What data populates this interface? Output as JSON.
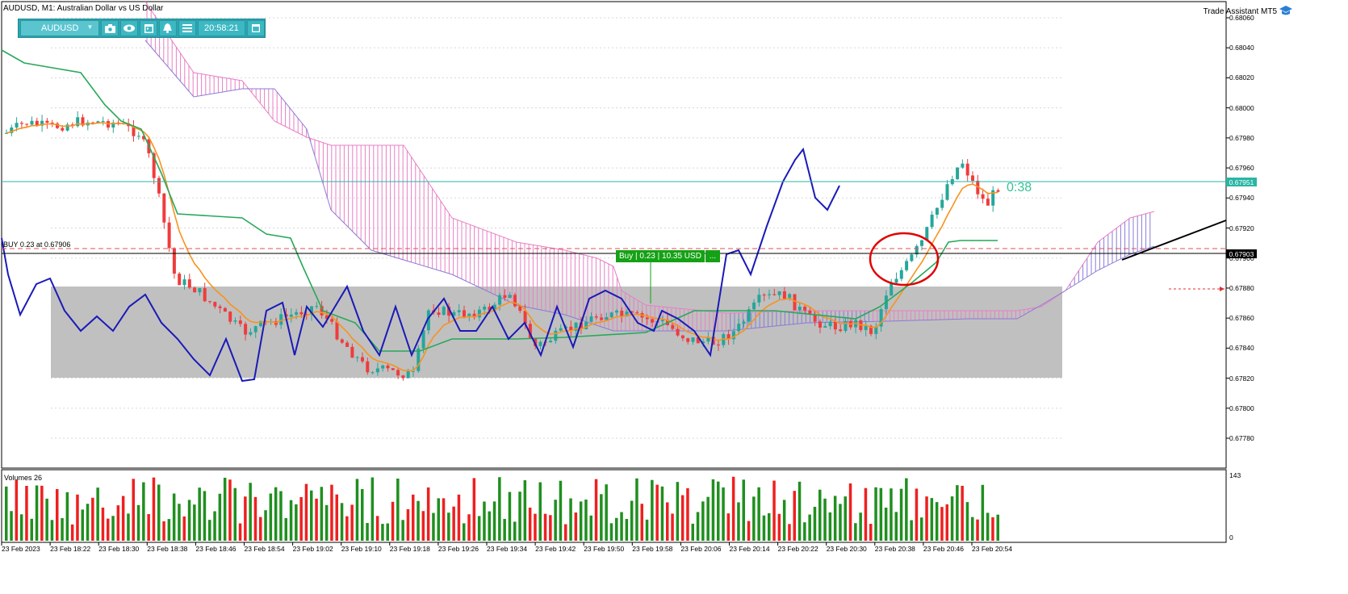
{
  "window": {
    "title": "AUDUSD, M1:  Australian Dollar vs US Dollar",
    "brand": "Trade Assistant MT5"
  },
  "toolbar": {
    "symbol": "AUDUSD",
    "time": "20:58:21",
    "icons": [
      "camera-icon",
      "eye-icon",
      "calendar-icon",
      "alarm-icon",
      "menu-icon",
      "window-icon"
    ]
  },
  "price_axis": {
    "labels": [
      "0.68060",
      "0.68040",
      "0.68020",
      "0.68000",
      "0.67980",
      "0.67960",
      "0.67940",
      "0.67920",
      "0.67900",
      "0.67880",
      "0.67860",
      "0.67840",
      "0.67820",
      "0.67800",
      "0.67780"
    ],
    "current_price": "0.67951",
    "buy_price": "0.67903"
  },
  "time_axis": {
    "labels": [
      "23 Feb 2023",
      "23 Feb 18:22",
      "23 Feb 18:30",
      "23 Feb 18:38",
      "23 Feb 18:46",
      "23 Feb 18:54",
      "23 Feb 19:02",
      "23 Feb 19:10",
      "23 Feb 19:18",
      "23 Feb 19:26",
      "23 Feb 19:34",
      "23 Feb 19:42",
      "23 Feb 19:50",
      "23 Feb 19:58",
      "23 Feb 20:06",
      "23 Feb 20:14",
      "23 Feb 20:22",
      "23 Feb 20:30",
      "23 Feb 20:38",
      "23 Feb 20:46",
      "23 Feb 20:54"
    ]
  },
  "trade": {
    "buy_line_label": "BUY 0.23 at 0.67906",
    "buy_tag": "Buy | 0.23 | 10.35 USD",
    "buy_tag_more": "...",
    "countdown": "0:38"
  },
  "volumes": {
    "label": "Volumes 26",
    "max": "143",
    "zero": "0"
  },
  "colors": {
    "bull": "#26a69a",
    "bear": "#ef3c3c",
    "cloud": "#e77fc4",
    "cloud_alt": "#8a7bd8",
    "tenkan": "#f7931e",
    "kijun": "#27a85a",
    "chikou": "#1a1ab8",
    "price_line": "#2ab5a4",
    "toolbar": "#2aa6b1"
  }
}
